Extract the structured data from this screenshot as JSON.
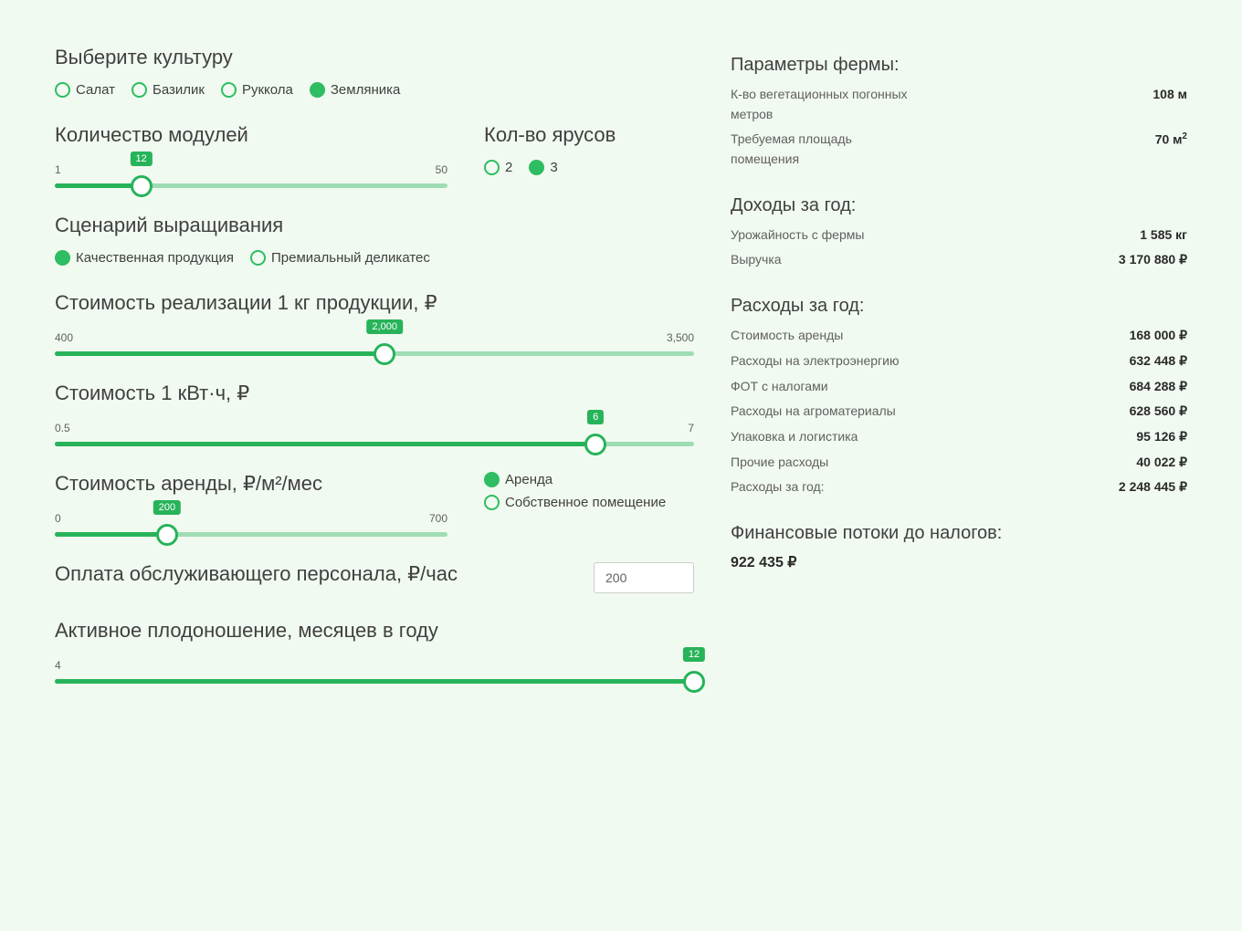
{
  "culture": {
    "heading": "Выберите культуру",
    "options": [
      "Салат",
      "Базилик",
      "Руккола",
      "Земляника"
    ],
    "selected_index": 3
  },
  "modules": {
    "heading": "Количество модулей",
    "min_label": "1",
    "max_label": "50",
    "value": "12",
    "fill_pct": 22
  },
  "tiers": {
    "heading": "Кол-во ярусов",
    "options": [
      "2",
      "3"
    ],
    "selected_index": 1
  },
  "scenario": {
    "heading": "Сценарий выращивания",
    "options": [
      "Качественная продукция",
      "Премиальный деликатес"
    ],
    "selected_index": 0
  },
  "price_kg": {
    "heading": "Стоимость реализации 1 кг продукции, ₽",
    "min_label": "400",
    "max_label": "3,500",
    "value": "2,000",
    "fill_pct": 51.6
  },
  "kwh": {
    "heading": "Стоимость 1 кВт·ч, ₽",
    "min_label": "0.5",
    "max_label": "7",
    "value": "6",
    "fill_pct": 84.6
  },
  "rent": {
    "heading": "Стоимость аренды, ₽/м²/мес",
    "min_label": "0",
    "max_label": "700",
    "value": "200",
    "fill_pct": 28.6,
    "options": [
      "Аренда",
      "Собственное помещение"
    ],
    "selected_index": 0
  },
  "staff": {
    "heading": "Оплата обслуживающего персонала, ₽/час",
    "value": "200"
  },
  "fruiting": {
    "heading": "Активное плодоношение, месяцев в году",
    "min_label": "4",
    "max_label": "",
    "value": "12",
    "fill_pct": 100
  },
  "farm_params": {
    "heading": "Параметры фермы:",
    "rows": [
      {
        "label": "К-во вегетационных погонных метров",
        "value": "108 м"
      },
      {
        "label": "Требуемая площадь помещения",
        "value": "70 м²"
      }
    ]
  },
  "income": {
    "heading": "Доходы за год:",
    "rows": [
      {
        "label": "Урожайность с фермы",
        "value": "1 585 кг"
      },
      {
        "label": "Выручка",
        "value": "3 170 880 ₽"
      }
    ]
  },
  "expenses": {
    "heading": "Расходы за год:",
    "rows": [
      {
        "label": "Стоимость аренды",
        "value": "168 000 ₽"
      },
      {
        "label": "Расходы на электроэнергию",
        "value": "632 448 ₽"
      },
      {
        "label": "ФОТ с налогами",
        "value": "684 288 ₽"
      },
      {
        "label": "Расходы на агроматериалы",
        "value": "628 560 ₽"
      },
      {
        "label": "Упаковка и логистика",
        "value": "95 126 ₽"
      },
      {
        "label": "Прочие расходы",
        "value": "40 022 ₽"
      },
      {
        "label": "Расходы за год:",
        "value": "2 248 445 ₽"
      }
    ]
  },
  "cashflow": {
    "heading": "Финансовые потоки до налогов:",
    "value": "922 435 ₽"
  }
}
